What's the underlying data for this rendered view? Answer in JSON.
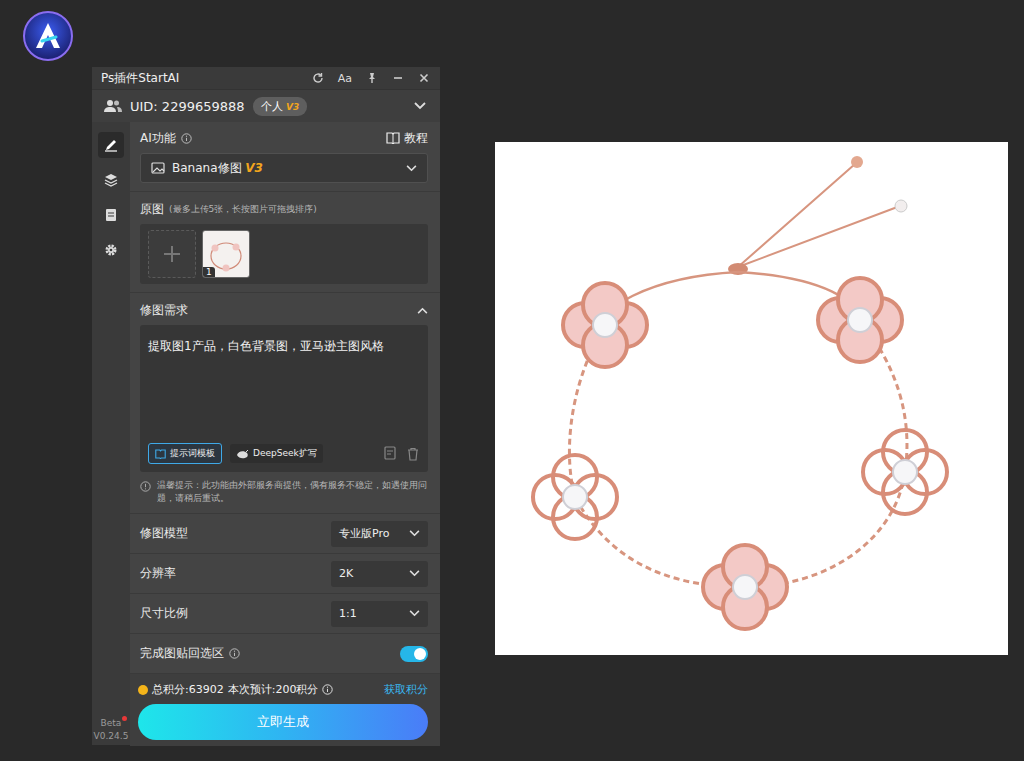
{
  "window": {
    "title": "Ps插件StartAI",
    "font_button": "Aa"
  },
  "account": {
    "uid": "UID: 2299659888",
    "plan": "个人",
    "plan_version": "V3",
    "expanded": false
  },
  "rail": {
    "items": [
      {
        "kind": "edit",
        "selected": true
      },
      {
        "kind": "layers",
        "selected": false
      },
      {
        "kind": "document",
        "selected": false
      },
      {
        "kind": "settings",
        "selected": false
      }
    ],
    "beta": "Beta",
    "version": "V0.24.5",
    "has_notice": true
  },
  "ai_function": {
    "label": "AI功能",
    "tutorial": "教程",
    "value": "Banana修图",
    "value_version": "V3"
  },
  "source_images": {
    "label": "原图",
    "hint": "(最多上传5张，长按图片可拖拽排序)",
    "images": [
      {
        "index": "1"
      }
    ]
  },
  "requirement": {
    "label": "修图需求",
    "expanded": true,
    "text": "提取图1产品，白色背景图，亚马逊主图风格",
    "template_button": "提示词模板",
    "expand_button": "DeepSeek扩写"
  },
  "notice": "温馨提示：此功能由外部服务商提供，偶有服务不稳定，如遇使用问题，请稍后重试。",
  "settings": [
    {
      "label": "修图模型",
      "kind": "select",
      "value": "专业版Pro",
      "info": false,
      "on": false
    },
    {
      "label": "分辨率",
      "kind": "select",
      "value": "2K",
      "info": false,
      "on": false
    },
    {
      "label": "尺寸比例",
      "kind": "select",
      "value": "1:1",
      "info": false,
      "on": false
    },
    {
      "label": "完成图贴回选区",
      "kind": "toggle",
      "value": "",
      "info": true,
      "on": true
    }
  ],
  "footer": {
    "total": "总积分:63902",
    "estimate": "本次预计:200积分",
    "get_points": "获取积分",
    "generate": "立即生成"
  }
}
